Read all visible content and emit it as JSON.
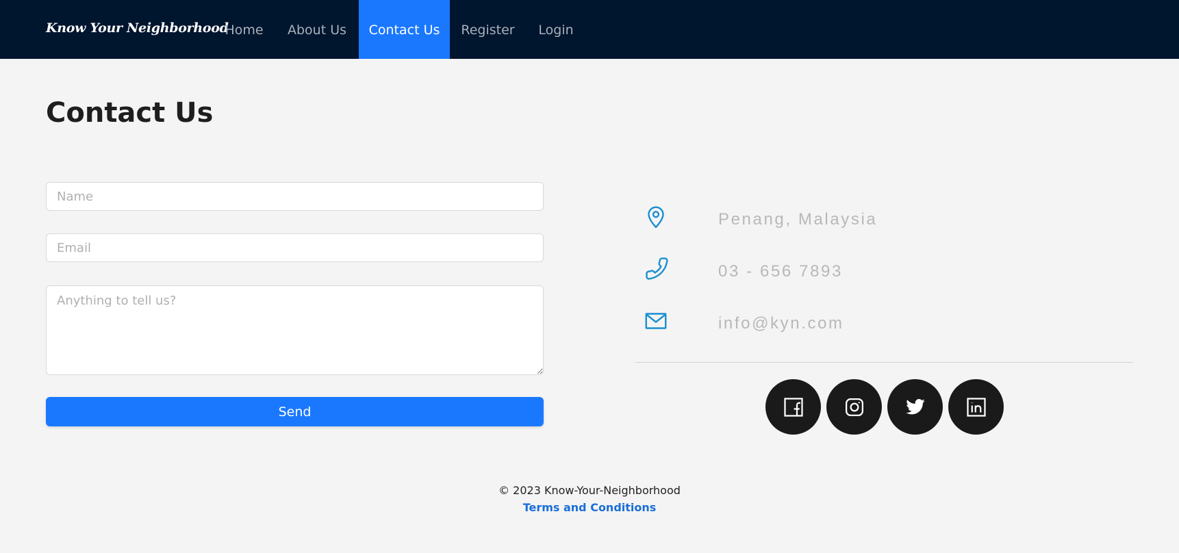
{
  "nav": {
    "brand": "Know Your Neighborhood",
    "items": [
      {
        "label": "Home"
      },
      {
        "label": "About Us"
      },
      {
        "label": "Contact Us",
        "active": true
      },
      {
        "label": "Register"
      },
      {
        "label": "Login"
      }
    ]
  },
  "page": {
    "title": "Contact Us"
  },
  "form": {
    "name_placeholder": "Name",
    "email_placeholder": "Email",
    "message_placeholder": "Anything to tell us?",
    "send_label": "Send"
  },
  "contact": {
    "location": "Penang, Malaysia",
    "phone": "03 - 656 7893",
    "email": "info@kyn.com",
    "icon_color": "#1a8fd0"
  },
  "social": [
    {
      "icon": "facebook-icon"
    },
    {
      "icon": "instagram-icon"
    },
    {
      "icon": "twitter-icon"
    },
    {
      "icon": "linkedin-icon"
    }
  ],
  "footer": {
    "copyright": "© 2023 Know-Your-Neighborhood",
    "terms": "Terms and Conditions"
  },
  "colors": {
    "nav_bg": "#00152e",
    "accent": "#1a78ff",
    "page_bg": "#f4f4f4"
  }
}
